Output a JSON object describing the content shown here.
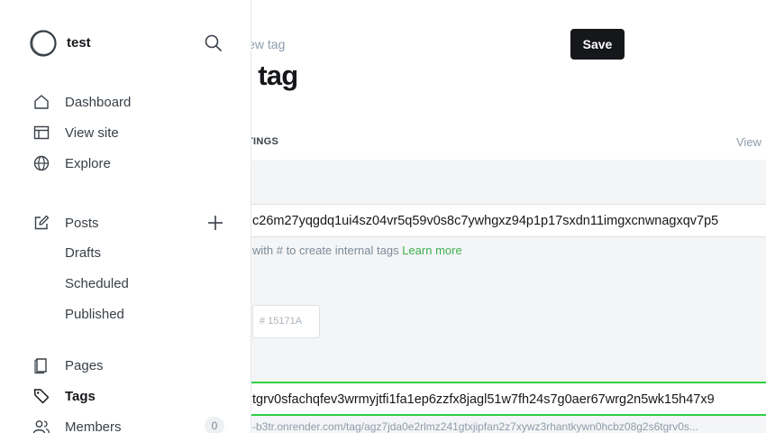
{
  "editor": {
    "breadcrumb": "iew tag",
    "save_label": "Save",
    "title": "v tag",
    "section_label": "TINGS",
    "view_label": "View",
    "name_value": "c26m27yqgdq1ui4sz04vr5q59v0s8c7ywhgxz94p1p17sxdn11imgxcnwnagxqv7p5",
    "hint_text": "with # to create internal tags ",
    "hint_link": "Learn more",
    "color_value": "# 15171A",
    "slug_value": "tgrv0sfachqfev3wrmyjtfi1fa1ep6zzfx8jagl51w7fh24s7g0aer67wrg2n5wk15h47x9",
    "url_text": "-b3tr.onrender.com/tag/agz7jda0e2rlmz241gtxjipfan2z7xywz3rhantkywn0hcbz08g2s6tgrv0s..."
  },
  "sidebar": {
    "site_name": "test",
    "nav": {
      "dashboard": "Dashboard",
      "view_site": "View site",
      "explore": "Explore",
      "posts": "Posts",
      "drafts": "Drafts",
      "scheduled": "Scheduled",
      "published": "Published",
      "pages": "Pages",
      "tags": "Tags",
      "members": "Members"
    },
    "members_count": "0"
  },
  "colors": {
    "accent_green": "#30cf43",
    "dark": "#15171a",
    "muted": "#8e9cac"
  }
}
